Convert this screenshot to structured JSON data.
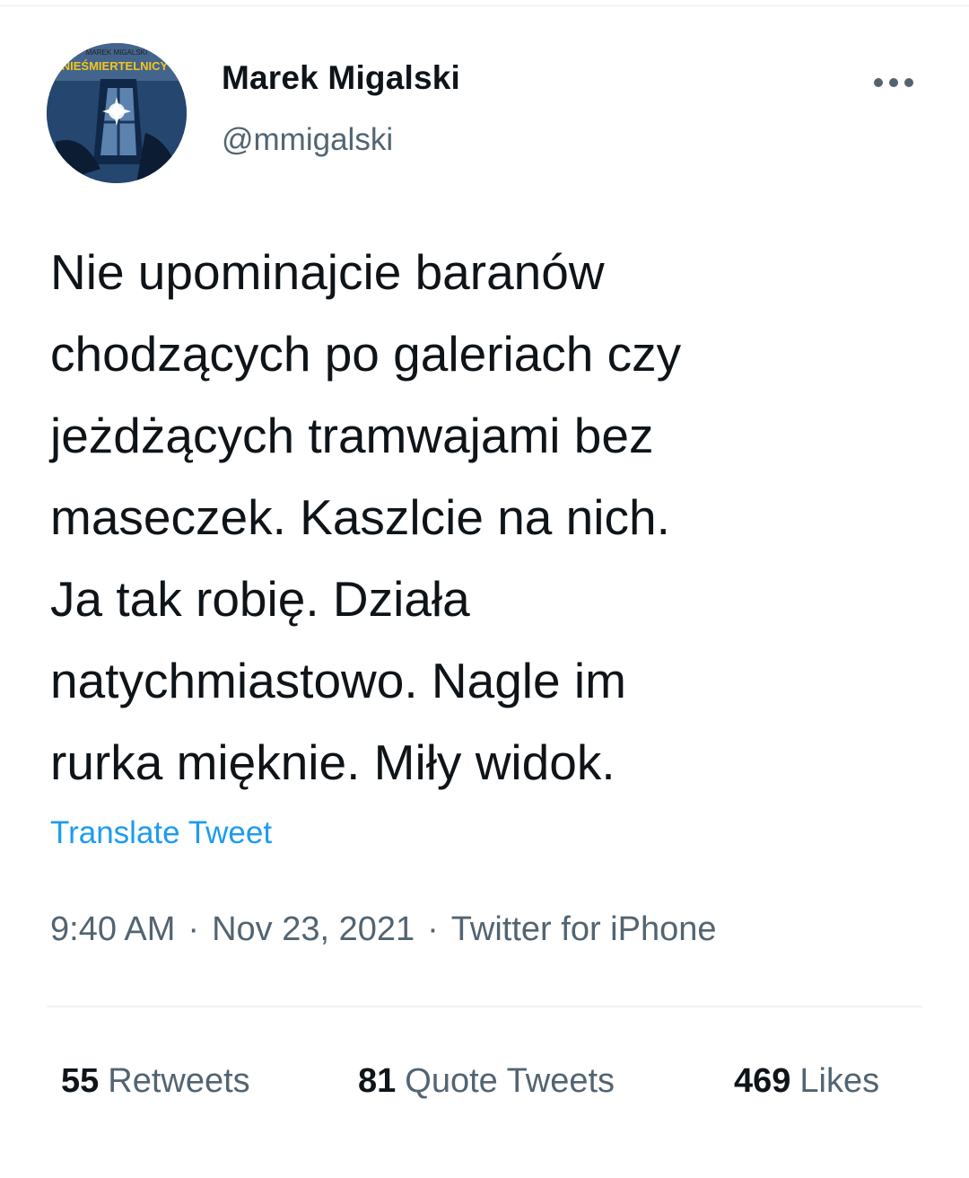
{
  "tweet": {
    "author": {
      "display_name": "Marek Migalski",
      "handle": "@mmigalski",
      "avatar": {
        "icon": "book-cover-avatar",
        "cover_author": "MAREK MIGALSKI",
        "cover_title": "NIEŚMIERTELNICY"
      }
    },
    "more_icon": "ellipsis-icon",
    "text": "Nie upominajcie baranów\nchodzących po galeriach czy\njeżdżących tramwajami bez\nmaseczek. Kaszlcie na nich.\nJa tak robię. Działa\nnatychmiastowo. Nagle im\nrurka mięknie. Miły widok.",
    "translate_label": "Translate Tweet",
    "time": "9:40 AM",
    "separator": "·",
    "date": "Nov 23, 2021",
    "source": "Twitter for iPhone",
    "stats": {
      "retweets": {
        "count": "55",
        "label": "Retweets"
      },
      "quote_tweets": {
        "count": "81",
        "label": "Quote Tweets"
      },
      "likes": {
        "count": "469",
        "label": "Likes"
      }
    }
  },
  "colors": {
    "link": "#1d9bf0",
    "text_primary": "#0f1419",
    "text_secondary": "#536471",
    "divider": "#eff3f4"
  }
}
